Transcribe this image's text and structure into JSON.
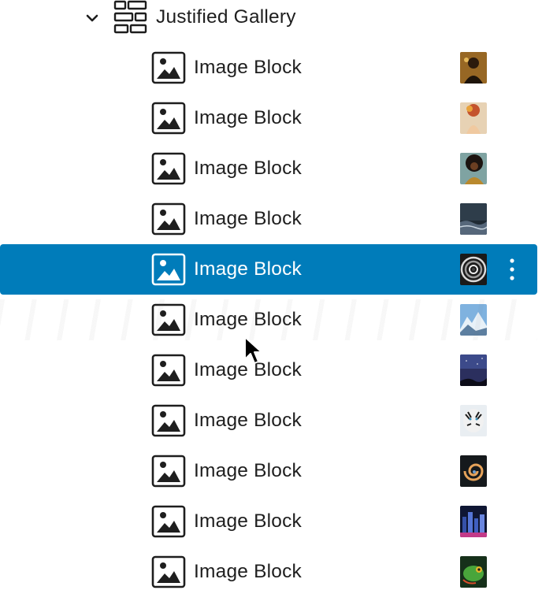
{
  "list_view": {
    "parent": {
      "label": "Justified Gallery",
      "icon": "gallery-icon",
      "expand_icon": "chevron-down-icon",
      "expanded": true
    },
    "items": [
      {
        "label": "Image Block",
        "icon": "image-icon",
        "thumb": "portrait-gold",
        "selected": false
      },
      {
        "label": "Image Block",
        "icon": "image-icon",
        "thumb": "flowers-head",
        "selected": false
      },
      {
        "label": "Image Block",
        "icon": "image-icon",
        "thumb": "afro-portrait",
        "selected": false
      },
      {
        "label": "Image Block",
        "icon": "image-icon",
        "thumb": "stormy-sea",
        "selected": false
      },
      {
        "label": "Image Block",
        "icon": "image-icon",
        "thumb": "spiral-staircase",
        "selected": true
      },
      {
        "label": "Image Block",
        "icon": "image-icon",
        "thumb": "mountains",
        "selected": false
      },
      {
        "label": "Image Block",
        "icon": "image-icon",
        "thumb": "night-sky",
        "selected": false
      },
      {
        "label": "Image Block",
        "icon": "image-icon",
        "thumb": "tiger",
        "selected": false
      },
      {
        "label": "Image Block",
        "icon": "image-icon",
        "thumb": "nautilus-shell",
        "selected": false
      },
      {
        "label": "Image Block",
        "icon": "image-icon",
        "thumb": "city-night",
        "selected": false
      },
      {
        "label": "Image Block",
        "icon": "image-icon",
        "thumb": "chameleon",
        "selected": false
      }
    ],
    "options_icon": "more-vertical-icon",
    "colors": {
      "selected_bg": "#007cba",
      "text": "#1e1e1e",
      "selected_text": "#ffffff"
    }
  }
}
